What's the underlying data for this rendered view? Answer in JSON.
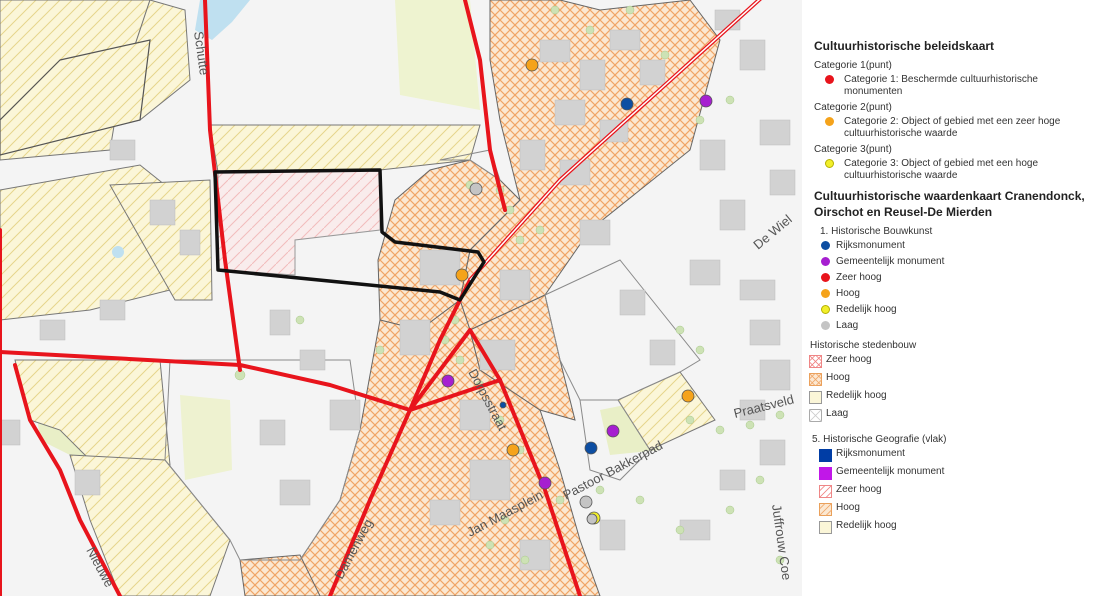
{
  "map": {
    "streets": [
      "De Wiel",
      "Praatsveld",
      "Dorpsstraat",
      "Pastoor Bakkerpad",
      "Jan Maasplein",
      "Damenweg",
      "Juffrouw Coe",
      "Nieuwe",
      "Schutte"
    ]
  },
  "legend": {
    "title1": "Cultuurhistorische beleidskaart",
    "cat1_label": "Categorie 1(punt)",
    "cat1_item": "Categorie 1: Beschermde cultuurhistorische monumenten",
    "cat2_label": "Categorie 2(punt)",
    "cat2_item": "Categorie 2: Object of gebied met een zeer hoge cultuurhistorische waarde",
    "cat3_label": "Categorie 3(punt)",
    "cat3_item": "Categorie 3: Object of gebied met een hoge cultuurhistorische waarde",
    "title2": "Cultuurhistorische waardenkaart Cranendonck, Oirschot en Reusel-De Mierden",
    "bouwkunst_label": "1. Historische Bouwkunst",
    "bouwkunst_items": [
      "Rijksmonument",
      "Gemeentelijk monument",
      "Zeer hoog",
      "Hoog",
      "Redelijk hoog",
      "Laag"
    ],
    "stedenbouw_label": "Historische stedenbouw",
    "stedenbouw_items": [
      "Zeer hoog",
      "Hoog",
      "Redelijk hoog",
      "Laag"
    ],
    "geografie_label": "5. Historische Geografie (vlak)",
    "geografie_items": [
      "Rijksmonument",
      "Gemeentelijk monument",
      "Zeer hoog",
      "Hoog",
      "Redelijk hoog"
    ]
  },
  "colors": {
    "red": "#e8141c",
    "orange": "#f5a31b",
    "yellow": "#f2ef2a",
    "blue": "#0d4ea2",
    "purple": "#a61fd0",
    "gray": "#c4c4c4",
    "hatch_orange": "#f0a566",
    "hatch_yellow": "#e9d98a",
    "geo_blue": "#003da5",
    "geo_purple": "#c117e8"
  }
}
